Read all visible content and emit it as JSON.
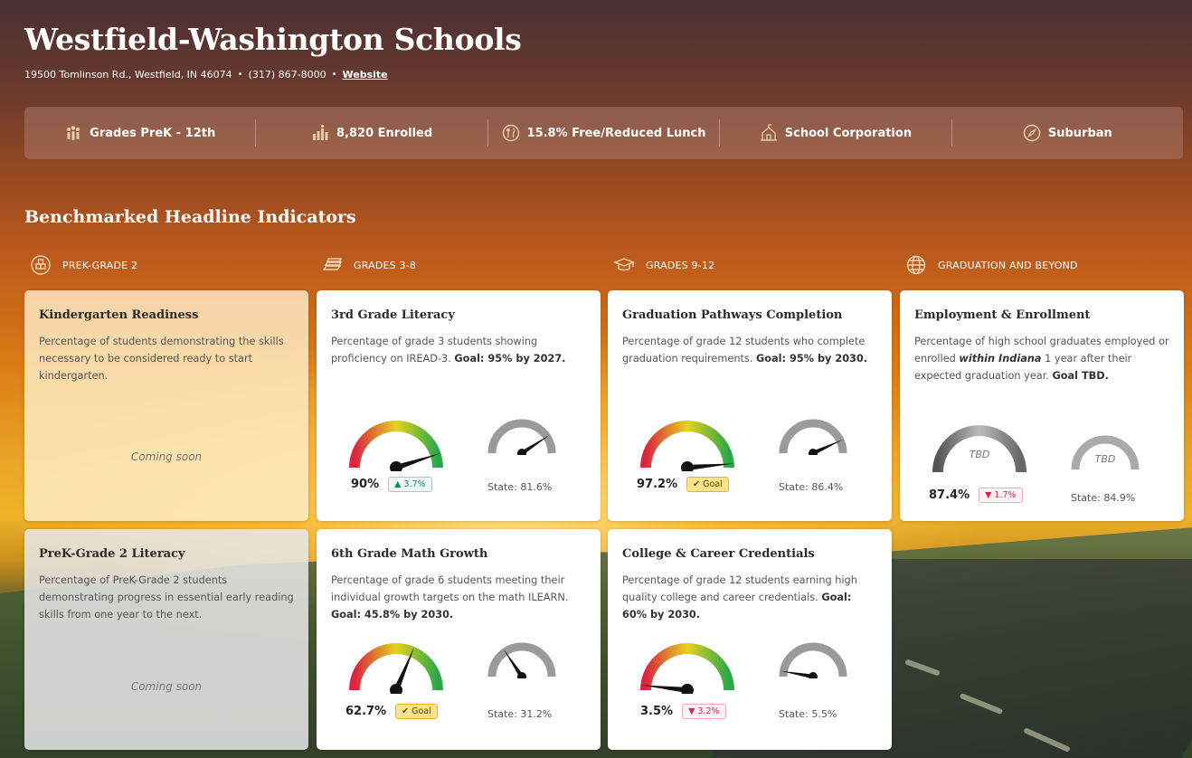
{
  "district": {
    "name": "Westfield-Washington Schools",
    "address": "19500 Tomlinson Rd., Westfield, IN 46074",
    "phone": "(317) 867-8000",
    "website_label": "Website",
    "separator": "•"
  },
  "info": [
    {
      "label": "Grades PreK - 12th",
      "icon": "people-icon"
    },
    {
      "label": "8,820 Enrolled",
      "icon": "chart-people-icon"
    },
    {
      "label": "15.8% Free/Reduced Lunch",
      "icon": "utensils-icon"
    },
    {
      "label": "School Corporation",
      "icon": "school-building-icon"
    },
    {
      "label": "Suburban",
      "icon": "compass-icon"
    }
  ],
  "section_title": "Benchmarked Headline Indicators",
  "columns": [
    {
      "label": "PREK-GRADE 2",
      "icon": "blocks-icon"
    },
    {
      "label": "GRADES 3-8",
      "icon": "books-icon"
    },
    {
      "label": "GRADES 9-12",
      "icon": "graduation-cap-icon"
    },
    {
      "label": "GRADUATION AND BEYOND",
      "icon": "globe-icon"
    }
  ],
  "cards": {
    "k_readiness": {
      "title": "Kindergarten Readiness",
      "desc": "Percentage of students demonstrating the skills necessary to be considered ready to start kindergarten.",
      "status": "Coming soon"
    },
    "literacy3": {
      "title": "3rd Grade Literacy",
      "desc": "Percentage of grade 3 students showing proficiency on IREAD-3. ",
      "goal": "Goal: 95% by 2027.",
      "value": "90%",
      "delta": "3.7%",
      "state": "State: 81.6%",
      "value_pct": 90,
      "state_pct": 81.6
    },
    "grad_pathways": {
      "title": "Graduation Pathways Completion",
      "desc": "Percentage of grade 12 students who complete graduation requirements. ",
      "goal": "Goal: 95% by 2030.",
      "value": "97.2%",
      "delta": "Goal",
      "state": "State: 86.4%",
      "value_pct": 97.2,
      "state_pct": 86.4
    },
    "employment": {
      "title": "Employment & Enrollment",
      "desc_a": "Percentage of high school graduates employed or enrolled ",
      "desc_em": "within Indiana",
      "desc_b": " 1 year after their expected graduation year.",
      "goal": "Goal TBD.",
      "gauge_label": "TBD",
      "state_gauge_label": "TBD",
      "value": "87.4%",
      "delta": "1.7%",
      "state": "State: 84.9%"
    },
    "prek_literacy": {
      "title": "PreK-Grade 2 Literacy",
      "desc": "Percentage of PreK-Grade 2 students demonstrating progress in essential early reading skills from one year to the next.",
      "status": "Coming soon"
    },
    "math6": {
      "title": "6th Grade Math Growth",
      "desc": "Percentage of grade 6 students meeting their individual growth targets on the math ILEARN. ",
      "goal": "Goal: 45.8% by 2030.",
      "value": "62.7%",
      "delta": "Goal",
      "state": "State: 31.2%",
      "value_pct": 62.7,
      "state_pct": 31.2
    },
    "credentials": {
      "title": "College & Career Credentials",
      "desc": "Percentage of grade 12 students earning high quality college and career credentials. ",
      "goal": "Goal: 60% by 2030.",
      "value": "3.5%",
      "delta": "3.2%",
      "state": "State: 5.5%",
      "value_pct": 3.5,
      "state_pct": 5.5
    }
  },
  "colors": {
    "gauge_red": "#d9253f",
    "gauge_yellow": "#e4d21e",
    "gauge_green": "#2aa84a",
    "state_gauge": "#9a9a9a"
  }
}
